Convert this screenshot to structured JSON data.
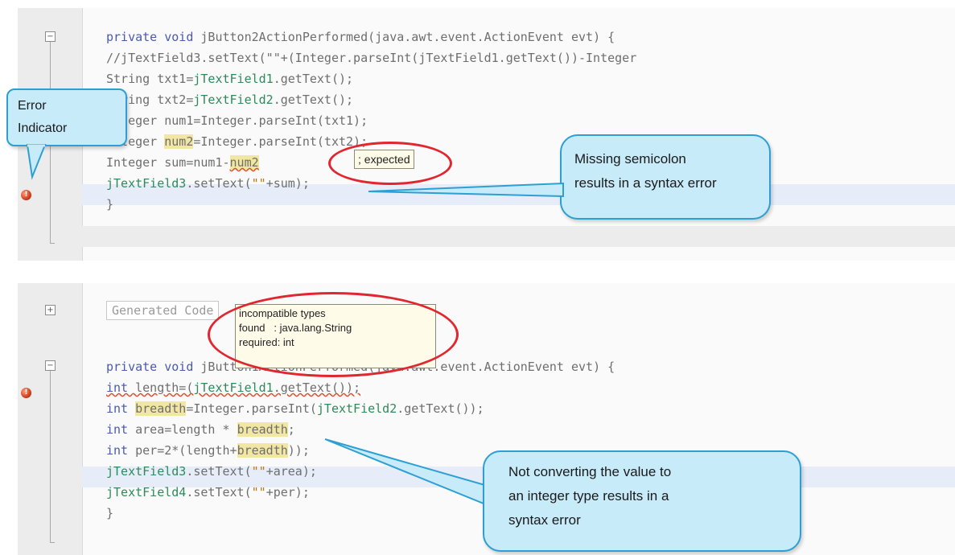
{
  "top_panel": {
    "code_lines": [
      {
        "pre": "",
        "tokens": [
          [
            "kw",
            "private void "
          ],
          [
            "",
            "jButton2ActionPerformed(java.awt.event.ActionEvent evt) {"
          ]
        ]
      },
      {
        "tokens": [
          [
            "",
            "//jTextField3.setText(\"\"+(Integer.parseInt(jTextField1.getText())-Integer"
          ]
        ]
      },
      {
        "tokens": [
          [
            "",
            "String txt1="
          ],
          [
            "fld",
            "jTextField1"
          ],
          [
            "",
            ".getText();"
          ]
        ]
      },
      {
        "tokens": [
          [
            "",
            "String txt2="
          ],
          [
            "fld",
            "jTextField2"
          ],
          [
            "",
            ".getText();"
          ]
        ]
      },
      {
        "tokens": [
          [
            "",
            "Integer num1=Integer.parseInt(txt1);"
          ]
        ]
      },
      {
        "tokens": [
          [
            "",
            "Integer "
          ],
          [
            "mark",
            "num2"
          ],
          [
            "",
            "=Integer.parseInt(txt2);"
          ]
        ]
      },
      {
        "tokens": [
          [
            "",
            "Integer sum=num1-"
          ],
          [
            "mark under",
            "num2"
          ]
        ]
      },
      {
        "tokens": [
          [
            "fld",
            "jTextField3"
          ],
          [
            "",
            ".setText("
          ],
          [
            "str",
            "\"\""
          ],
          [
            "",
            "+sum);"
          ]
        ]
      },
      {
        "tokens": [
          [
            "",
            "}"
          ]
        ]
      }
    ],
    "tooltip": "; expected",
    "callout_error_indicator": [
      "Error",
      "Indicator"
    ],
    "callout_semicolon": [
      "Missing semicolon",
      "results in a syntax error"
    ]
  },
  "bottom_panel": {
    "generated_label": "Generated Code",
    "tooltip_lines": [
      "incompatible types",
      "found   : java.lang.String",
      "required: int"
    ],
    "code_lines": [
      {
        "tokens": [
          [
            "kw",
            "private void "
          ],
          [
            "",
            "jButton1ActionPerformed(java.awt.event.ActionEvent evt) {"
          ]
        ]
      },
      {
        "tokens": [
          [
            "kw under",
            "int"
          ],
          [
            "under",
            " length=("
          ],
          [
            "fld under",
            "jTextField1"
          ],
          [
            "under",
            ".getText());"
          ]
        ]
      },
      {
        "tokens": [
          [
            "kw",
            "int "
          ],
          [
            "mark",
            "breadth"
          ],
          [
            "",
            "=Integer.parseInt("
          ],
          [
            "fld",
            "jTextField2"
          ],
          [
            "",
            ".getText());"
          ]
        ]
      },
      {
        "tokens": [
          [
            "kw",
            "int "
          ],
          [
            "",
            "area=length * "
          ],
          [
            "mark",
            "breadth"
          ],
          [
            "",
            ";"
          ]
        ]
      },
      {
        "tokens": [
          [
            "kw",
            "int "
          ],
          [
            "",
            "per=2*(length+"
          ],
          [
            "mark",
            "breadth"
          ],
          [
            "",
            "));"
          ]
        ]
      },
      {
        "tokens": [
          [
            "fld",
            "jTextField3"
          ],
          [
            "",
            ".setText("
          ],
          [
            "str",
            "\"\""
          ],
          [
            "",
            "+area);"
          ]
        ]
      },
      {
        "tokens": [
          [
            "fld",
            "jTextField4"
          ],
          [
            "",
            ".setText("
          ],
          [
            "str",
            "\"\""
          ],
          [
            "",
            "+per);"
          ]
        ]
      },
      {
        "tokens": [
          [
            "",
            "}"
          ]
        ]
      }
    ],
    "callout_conversion": [
      "Not converting the value to",
      "an integer type results in a",
      "syntax error"
    ]
  },
  "colors": {
    "callout_fill": "#c8ebfa",
    "callout_border": "#2d9fd2",
    "highlight_ellipse": "#e0262e",
    "error_icon": "#c6320e"
  },
  "icons": [
    "fold-collapse-icon",
    "fold-expand-icon",
    "error-icon"
  ]
}
